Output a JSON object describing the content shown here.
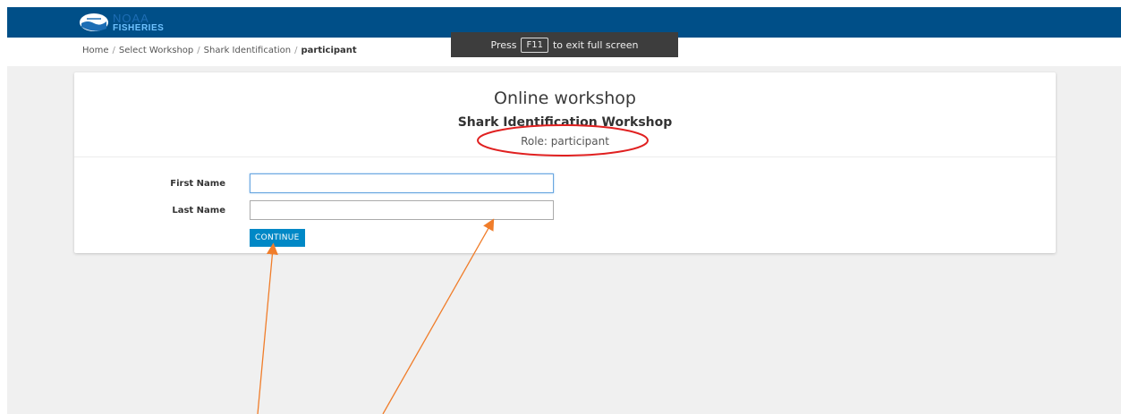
{
  "header": {
    "logo_noaa": "NOAA",
    "logo_fisheries": "FISHERIES",
    "brand_color": "#004f88"
  },
  "breadcrumb": {
    "items": [
      "Home",
      "Select Workshop",
      "Shark Identification"
    ],
    "current": "participant"
  },
  "fullscreen_toast": {
    "prefix": "Press",
    "key": "F11",
    "suffix": "to exit full screen"
  },
  "card": {
    "title": "Online workshop",
    "subtitle": "Shark Identification Workshop",
    "role": "Role: participant"
  },
  "form": {
    "first_name_label": "First Name",
    "first_name_value": "",
    "last_name_label": "Last Name",
    "last_name_value": "",
    "continue_label": "CONTINUE",
    "button_color": "#0088c6"
  },
  "annotations": {
    "circle_color": "#e02020",
    "arrow_color": "#f07d2a"
  }
}
